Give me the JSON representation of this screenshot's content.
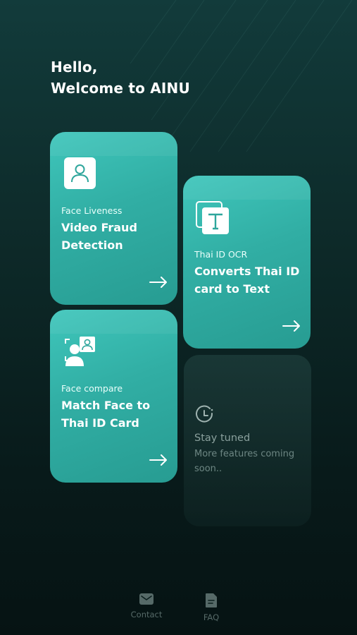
{
  "greeting": {
    "line1": "Hello,",
    "line2": "Welcome to AINU"
  },
  "cards": [
    {
      "kicker": "Face Liveness",
      "title": "Video Fraud Detection",
      "icon": "person-icon"
    },
    {
      "kicker": "Thai ID OCR",
      "title": "Converts Thai ID card to Text",
      "icon": "text-document-icon"
    },
    {
      "kicker": "Face compare",
      "title": "Match Face to Thai ID Card",
      "icon": "face-scan-icon"
    }
  ],
  "coming_soon": {
    "title": "Stay tuned",
    "subtitle": "More features coming soon..",
    "icon": "clock-icon"
  },
  "bottom_nav": [
    {
      "label": "Contact",
      "icon": "mail-icon"
    },
    {
      "label": "FAQ",
      "icon": "document-icon"
    }
  ],
  "colors": {
    "card_accent": "#34b5ab",
    "background": "#0d2928",
    "muted_text": "#6d8683"
  }
}
